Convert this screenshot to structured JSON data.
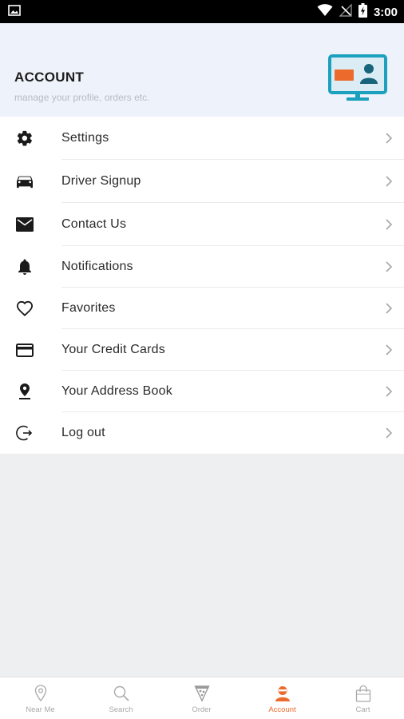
{
  "status_bar": {
    "time": "3:00"
  },
  "header": {
    "title": "ACCOUNT",
    "subtitle": "manage your profile, orders etc."
  },
  "menu": {
    "items": [
      {
        "label": "Settings",
        "icon": "gear-icon"
      },
      {
        "label": "Driver Signup",
        "icon": "car-icon"
      },
      {
        "label": "Contact Us",
        "icon": "envelope-icon"
      },
      {
        "label": "Notifications",
        "icon": "bell-icon"
      },
      {
        "label": "Favorites",
        "icon": "heart-icon"
      },
      {
        "label": "Your Credit Cards",
        "icon": "credit-card-icon"
      },
      {
        "label": "Your Address Book",
        "icon": "location-pin-icon"
      },
      {
        "label": "Log out",
        "icon": "logout-icon"
      }
    ]
  },
  "tabbar": {
    "tabs": [
      {
        "label": "Near Me",
        "icon": "map-pin-icon",
        "active": false
      },
      {
        "label": "Search",
        "icon": "search-icon",
        "active": false
      },
      {
        "label": "Order",
        "icon": "pizza-icon",
        "active": false
      },
      {
        "label": "Account",
        "icon": "user-icon",
        "active": true
      },
      {
        "label": "Cart",
        "icon": "shopping-bag-icon",
        "active": false
      }
    ]
  },
  "colors": {
    "accent": "#ec6a2c",
    "header_bg": "#edf2fb",
    "illustration_teal": "#1ba1bd",
    "page_bg": "#eeeff1"
  }
}
